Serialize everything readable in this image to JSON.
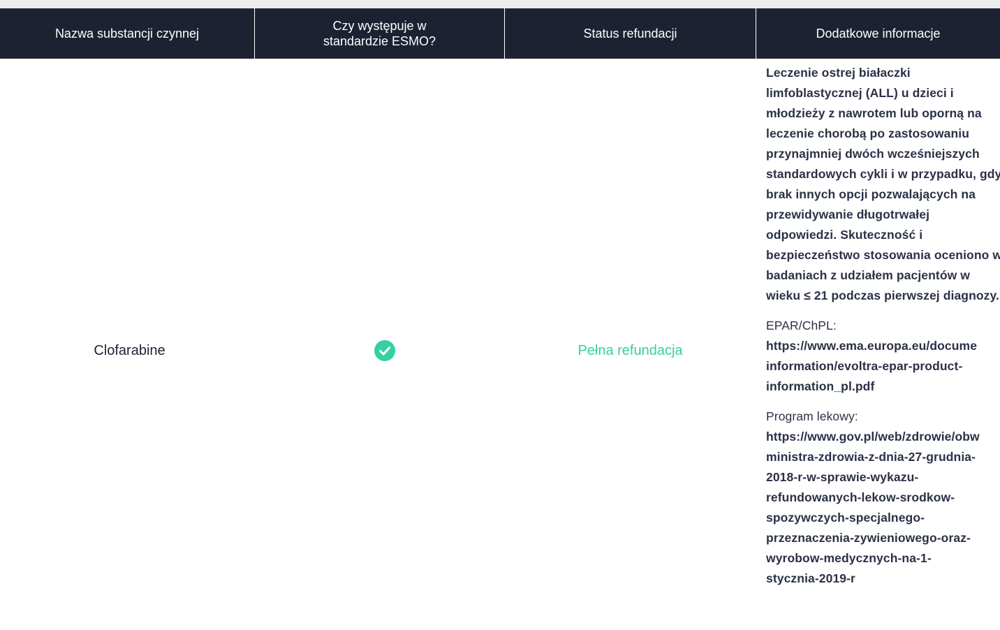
{
  "header": {
    "col1": "Nazwa substancji czynnej",
    "col2": "Czy występuje w standardzie ESMO?",
    "col3": "Status refundacji",
    "col4": "Dodatkowe informacje"
  },
  "row": {
    "substance": "Clofarabine",
    "esmo_icon": "check-circle-icon",
    "status": "Pełna refundacja",
    "description": "Leczenie ostrej białaczki limfoblastycznej (ALL) u dzieci i młodzieży z nawrotem lub oporną na leczenie chorobą po zastosowaniu przynajmniej dwóch wcześniejszych standardowych cykli i w przypadku, gdy brak innych opcji pozwalających na przewidywanie długotrwałej odpowiedzi. Skuteczność i bezpieczeństwo stosowania oceniono w badaniach z udziałem pacjentów w wieku ≤ 21 podczas pierwszej diagnozy.",
    "epar_label": "EPAR/ChPL:",
    "epar_link": "https://www.ema.europa.eu/docume\ninformation/evoltra-epar-product-\ninformation_pl.pdf",
    "program_label": "Program lekowy:",
    "program_link": "https://www.gov.pl/web/zdrowie/obw\nministra-zdrowia-z-dnia-27-grudnia-\n2018-r-w-sprawie-wykazu-\nrefundowanych-lekow-srodkow-\nspozywczych-specjalnego-\nprzeznaczenia-zywieniowego-oraz-\nwyrobow-medycznych-na-1-\nstycznia-2019-r"
  },
  "colors": {
    "header_bg": "#1d2232",
    "accent_green": "#35d0a3",
    "text_dark": "#2b3147"
  }
}
